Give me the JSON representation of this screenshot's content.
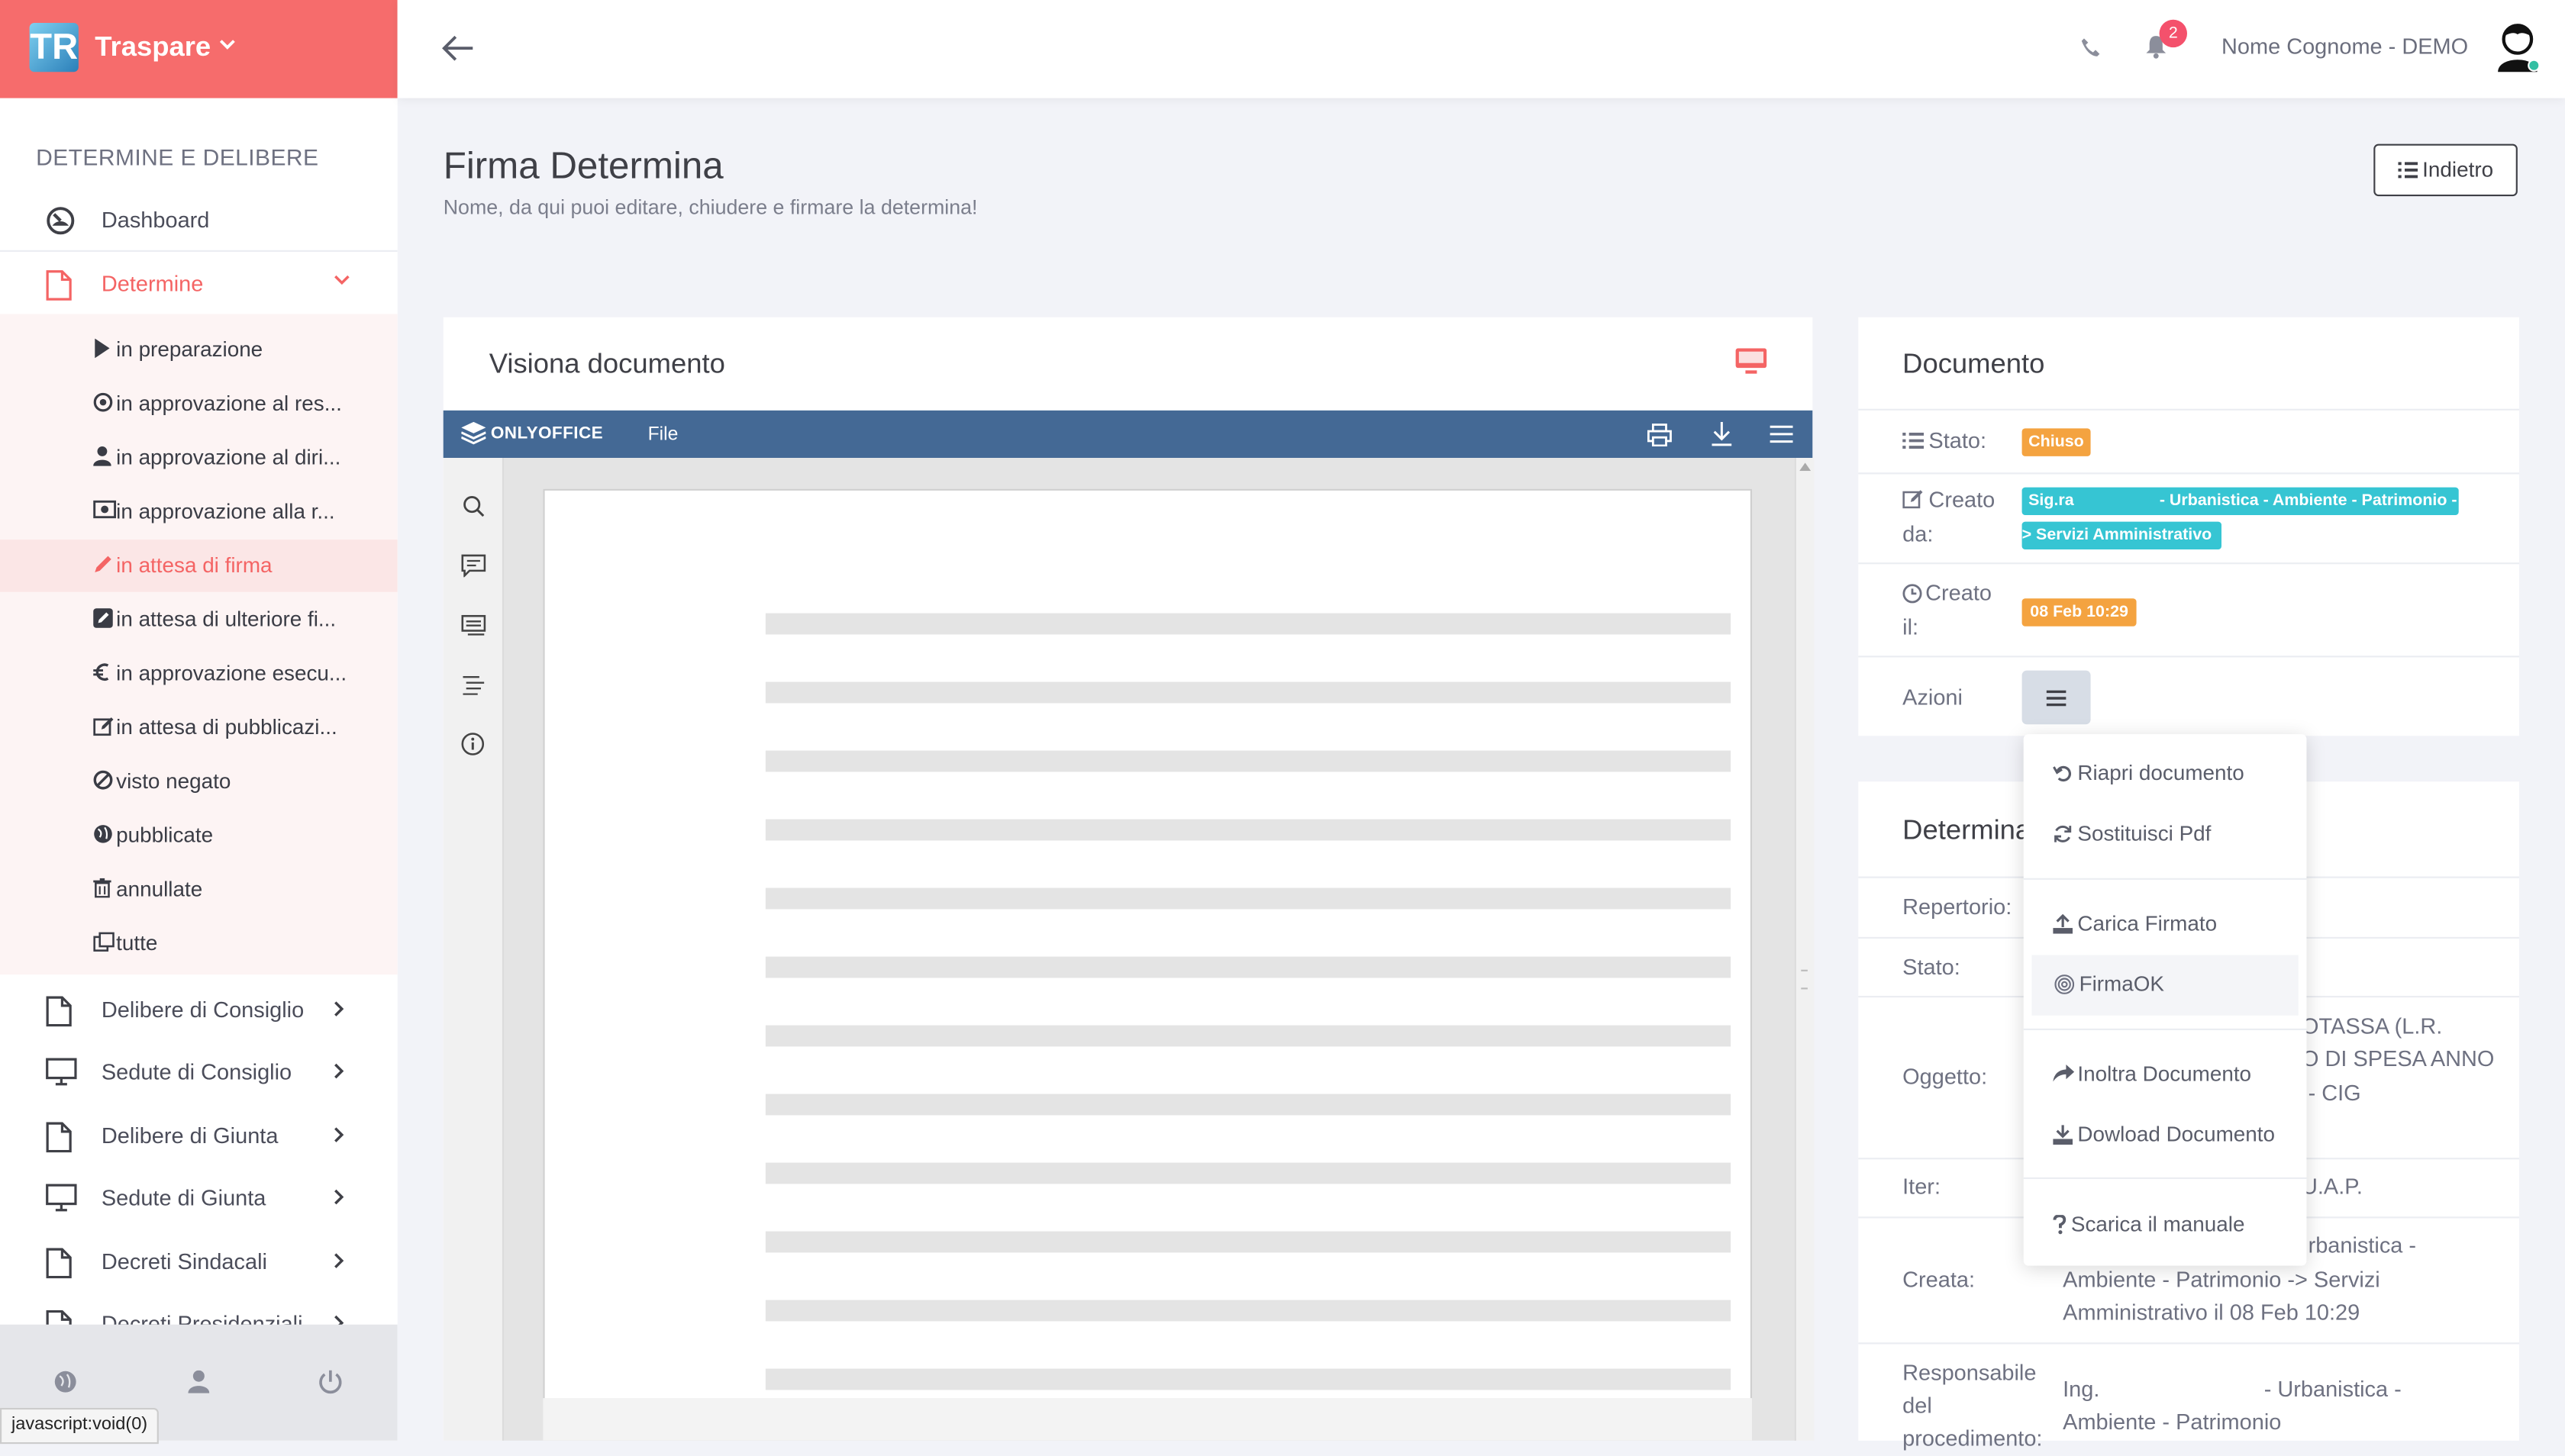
{
  "brand": {
    "name": "Traspare",
    "logo_text": "TR"
  },
  "sidebar": {
    "section_title": "DETERMINE E DELIBERE",
    "items": [
      {
        "label": "Dashboard",
        "icon": "dashboard-icon"
      },
      {
        "label": "Determine",
        "icon": "file-icon",
        "active": true
      },
      {
        "label": "Delibere di Consiglio",
        "icon": "file-icon"
      },
      {
        "label": "Sedute di Consiglio",
        "icon": "monitor-icon"
      },
      {
        "label": "Delibere di Giunta",
        "icon": "file-icon"
      },
      {
        "label": "Sedute di Giunta",
        "icon": "monitor-icon"
      },
      {
        "label": "Decreti Sindacali",
        "icon": "file-icon"
      },
      {
        "label": "Decreti Presidenziali",
        "icon": "file-icon"
      }
    ],
    "determine_sub": [
      {
        "label": "in preparazione",
        "icon": "play-icon"
      },
      {
        "label": "in approvazione al res...",
        "icon": "target-icon"
      },
      {
        "label": "in approvazione al diri...",
        "icon": "user-icon"
      },
      {
        "label": "in approvazione alla r...",
        "icon": "money-icon"
      },
      {
        "label": "in attesa di firma",
        "icon": "pencil-icon",
        "active": true
      },
      {
        "label": "in attesa di ulteriore fi...",
        "icon": "edit-square-icon"
      },
      {
        "label": "in approvazione esecu...",
        "icon": "euro-icon"
      },
      {
        "label": "in attesa di pubblicazi...",
        "icon": "edit-icon"
      },
      {
        "label": "visto negato",
        "icon": "ban-icon"
      },
      {
        "label": "pubblicate",
        "icon": "globe-icon"
      },
      {
        "label": "annullate",
        "icon": "trash-icon"
      },
      {
        "label": "tutte",
        "icon": "copy-icon"
      }
    ]
  },
  "statusbar": {
    "text": "javascript:void(0)"
  },
  "header": {
    "notifications": "2",
    "user_name": "Nome Cognome - DEMO"
  },
  "page": {
    "title": "Firma Determina",
    "subtitle": "Nome, da qui puoi editare, chiudere e firmare la determina!",
    "back_button": "Indietro"
  },
  "viewer": {
    "title": "Visiona documento",
    "onlyoffice_logo": "ONLYOFFICE",
    "file_menu": "File"
  },
  "documento": {
    "title": "Documento",
    "stato_label": "Stato:",
    "stato_value": "Chiuso",
    "creato_da_label_1": "Creato",
    "creato_da_label_2": "da:",
    "creato_da_line1_a": "Sig.ra",
    "creato_da_line1_b": "- Urbanistica - Ambiente - Patrimonio -",
    "creato_da_line2": "> Servizi Amministrativo",
    "creato_il_label_1": "Creato",
    "creato_il_label_2": "il:",
    "creato_il_value": "08 Feb 10:29",
    "azioni_label": "Azioni"
  },
  "determina": {
    "title": "Determina",
    "repertorio_label": "Repertorio:",
    "stato_label": "Stato:",
    "oggetto_label": "Oggetto:",
    "oggetto_lines": [
      "OTASSA (L.R.",
      "O DI SPESA ANNO",
      "- CIG"
    ],
    "iter_label": "Iter:",
    "iter_value": "U.A.P.",
    "creata_label": "Creata:",
    "creata_lines": [
      "rbanistica -",
      "Ambiente - Patrimonio -> Servizi",
      "Amministrativo il 08 Feb 10:29"
    ],
    "resp_label_lines": [
      "Responsabile",
      "del",
      "procedimento:"
    ],
    "resp_line1_a": "Ing.",
    "resp_line1_b": "- Urbanistica -",
    "resp_line2": "Ambiente - Patrimonio"
  },
  "azioni_menu": [
    {
      "label": "Riapri documento",
      "icon": "undo-icon"
    },
    {
      "label": "Sostituisci Pdf",
      "icon": "refresh-icon"
    },
    {
      "label": "Carica Firmato",
      "icon": "upload-icon"
    },
    {
      "label": "FirmaOK",
      "icon": "fingerprint-icon"
    },
    {
      "label": "Inoltra Documento",
      "icon": "share-icon"
    },
    {
      "label": "Dowload Documento",
      "icon": "download-icon"
    },
    {
      "label": "Scarica il manuale",
      "icon": "question-icon"
    }
  ],
  "colors": {
    "brand": "#f66c6c",
    "onlyoffice_bar": "#446995",
    "badge_orange": "#f4a340",
    "badge_teal": "#36c5d3",
    "badge_red": "#f4516c"
  }
}
